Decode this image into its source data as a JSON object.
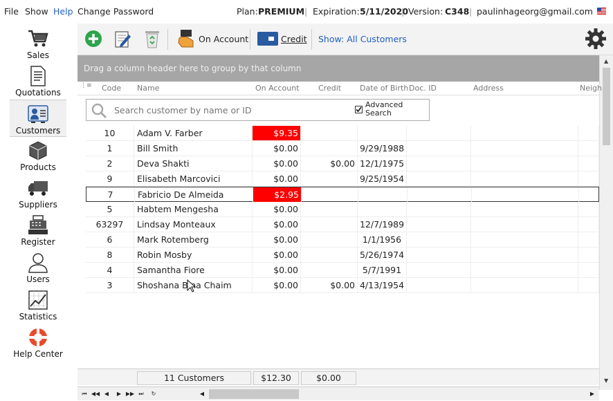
{
  "menu": {
    "file": "File",
    "show": "Show",
    "help": "Help",
    "change_password": "Change Password"
  },
  "status": {
    "plan_label": "Plan:",
    "plan_value": "PREMIUM",
    "expiration_label": "Expiration:",
    "expiration_value": "5/11/2020",
    "version_label": "Version:",
    "version_value": "C348",
    "email": "paulinhageorg@gmail.com",
    "separator": "|"
  },
  "sidebar": {
    "items": [
      {
        "label": "Sales"
      },
      {
        "label": "Quotations"
      },
      {
        "label": "Customers"
      },
      {
        "label": "Products"
      },
      {
        "label": "Suppliers"
      },
      {
        "label": "Register"
      },
      {
        "label": "Users"
      },
      {
        "label": "Statistics"
      },
      {
        "label": "Help Center"
      }
    ]
  },
  "toolbar": {
    "on_account": "On Account",
    "credit": "Credit",
    "show": "Show: All Customers"
  },
  "group_panel": "Drag a column header here to group by that column",
  "columns": [
    "Code",
    "Name",
    "On Account",
    "Credit",
    "Date of Birth",
    "Doc. ID",
    "Address",
    "Neigh"
  ],
  "search": {
    "placeholder": "Search customer by name or ID",
    "advanced_line1": "Advanced",
    "advanced_line2": "Search"
  },
  "rows": [
    {
      "code": "10",
      "name": "Adam V. Farber",
      "on_account": "$9.35",
      "credit": "",
      "dob": ""
    },
    {
      "code": "1",
      "name": "Bill Smith",
      "on_account": "$0.00",
      "credit": "",
      "dob": "9/29/1988"
    },
    {
      "code": "2",
      "name": "Deva Shakti",
      "on_account": "$0.00",
      "credit": "$0.00",
      "dob": "12/1/1975"
    },
    {
      "code": "9",
      "name": "Elisabeth Marcovici",
      "on_account": "$0.00",
      "credit": "",
      "dob": "9/25/1954"
    },
    {
      "code": "7",
      "name": "Fabricio De Almeida",
      "on_account": "$2.95",
      "credit": "",
      "dob": ""
    },
    {
      "code": "5",
      "name": "Habtem Mengesha",
      "on_account": "$0.00",
      "credit": "",
      "dob": ""
    },
    {
      "code": "63297",
      "name": "Lindsay Monteaux",
      "on_account": "$0.00",
      "credit": "",
      "dob": "12/7/1989"
    },
    {
      "code": "6",
      "name": "Mark Rotemberg",
      "on_account": "$0.00",
      "credit": "",
      "dob": "1/1/1956"
    },
    {
      "code": "8",
      "name": "Robin Mosby",
      "on_account": "$0.00",
      "credit": "",
      "dob": "5/26/1974"
    },
    {
      "code": "4",
      "name": "Samantha Fiore",
      "on_account": "$0.00",
      "credit": "",
      "dob": "5/7/1991"
    },
    {
      "code": "3",
      "name": "Shoshana Bina Chaim",
      "on_account": "$0.00",
      "credit": "$0.00",
      "dob": "4/13/1954"
    }
  ],
  "footer": {
    "count": "11 Customers",
    "on_account_total": "$12.30",
    "credit_total": "$0.00"
  },
  "colors": {
    "accent_blue": "#1f5fbf",
    "negative_bg": "#ff0000",
    "group_panel": "#a6a6a6"
  }
}
